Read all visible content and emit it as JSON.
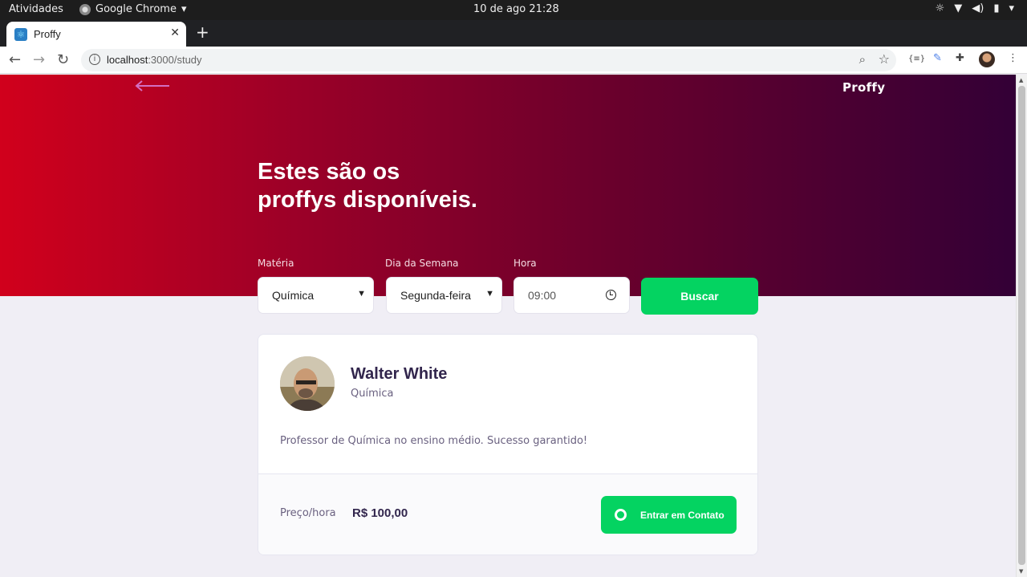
{
  "os": {
    "activities": "Atividades",
    "app_name": "Google Chrome",
    "datetime": "10 de ago  21:28"
  },
  "browser": {
    "tab_title": "Proffy",
    "url_host": "localhost",
    "url_path": ":3000/study"
  },
  "page": {
    "brand": "Proffy",
    "title_line1": "Estes são os",
    "title_line2": "proffys disponíveis.",
    "filters": {
      "subject_label": "Matéria",
      "subject_value": "Química",
      "weekday_label": "Dia da Semana",
      "weekday_value": "Segunda-feira",
      "time_label": "Hora",
      "time_value": "09:00",
      "search_label": "Buscar"
    },
    "teacher": {
      "name": "Walter White",
      "subject": "Química",
      "bio": "Professor de Química no ensino médio. Sucesso garantido!",
      "price_label": "Preço/hora",
      "price_value": "R$ 100,00",
      "contact_label": "Entrar em Contato"
    }
  },
  "colors": {
    "accent_green": "#04d361",
    "hero_start": "#d1001c",
    "hero_end": "#330036",
    "text_dark": "#32264d"
  }
}
